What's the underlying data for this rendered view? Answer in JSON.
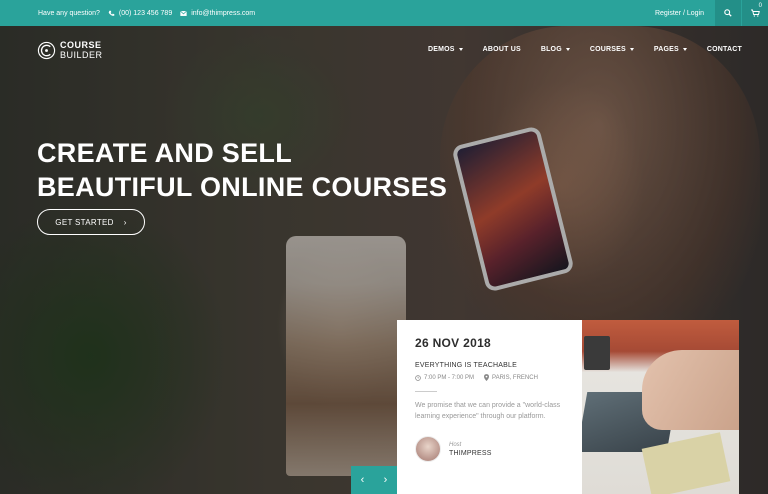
{
  "topbar": {
    "question": "Have any question?",
    "phone": "(00) 123 456 789",
    "email": "info@thimpress.com",
    "register": "Register / Login",
    "cart_count": "0"
  },
  "logo": {
    "line1": "COURSE",
    "line2": "BUILDER"
  },
  "nav": {
    "items": [
      {
        "label": "DEMOS",
        "dropdown": true
      },
      {
        "label": "ABOUT US",
        "dropdown": false
      },
      {
        "label": "BLOG",
        "dropdown": true
      },
      {
        "label": "COURSES",
        "dropdown": true
      },
      {
        "label": "PAGES",
        "dropdown": true
      },
      {
        "label": "CONTACT",
        "dropdown": false
      }
    ]
  },
  "hero": {
    "line1": "CREATE AND SELL",
    "line2": "BEAUTIFUL ONLINE COURSES",
    "cta": "GET STARTED",
    "cta_arrow": "›"
  },
  "event": {
    "date": "26 NOV 2018",
    "title": "EVERYTHING IS TEACHABLE",
    "time": "7:00 PM - 7:00 PM",
    "location": "PARIS, FRENCH",
    "description": "We promise that we can provide a \"world-class learning experience\" through our platform.",
    "host_label": "Host",
    "host_name": "THIMPRESS"
  },
  "slider": {
    "prev": "‹",
    "next": "›"
  },
  "colors": {
    "accent": "#2aa39b",
    "accent_dark": "#238f88"
  }
}
